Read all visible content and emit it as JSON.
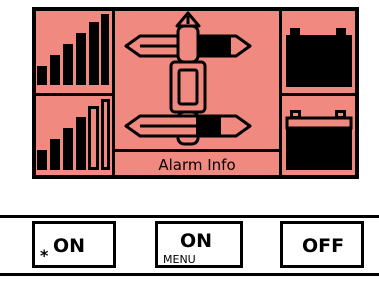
{
  "display": {
    "background_color": "#f08a80",
    "bar_label": "Alarm Info",
    "signal_icons": [
      "signal-bars-icon",
      "signal-bars-icon"
    ],
    "battery_icons": [
      "battery-icon",
      "battery-icon"
    ],
    "center_icon": "mast-sensor-icon"
  },
  "buttons": [
    {
      "label": "ON",
      "prefix": "*",
      "sub": ""
    },
    {
      "label": "ON",
      "prefix": "",
      "sub": "MENU"
    },
    {
      "label": "OFF",
      "prefix": "",
      "sub": ""
    }
  ]
}
